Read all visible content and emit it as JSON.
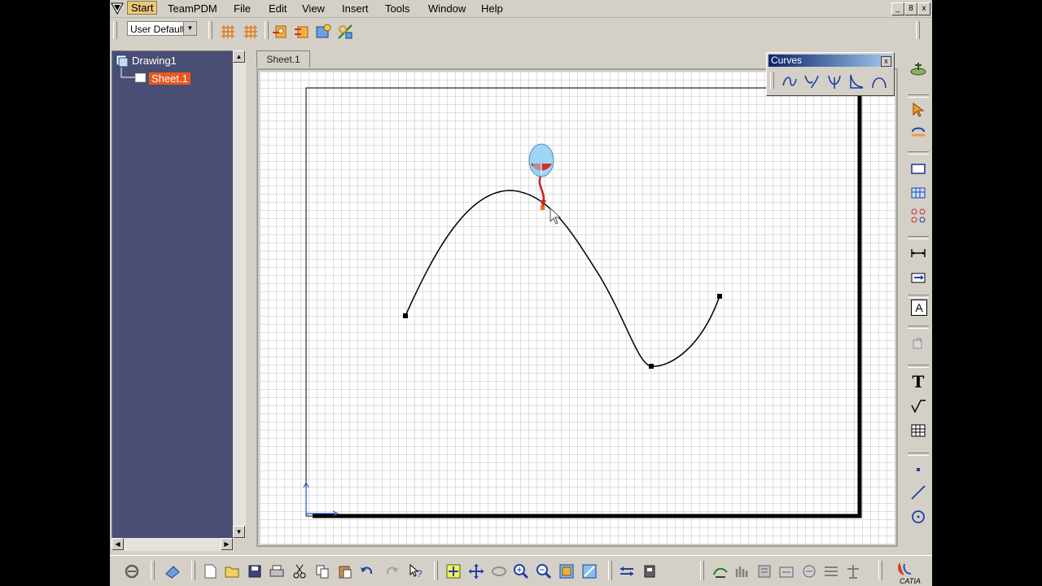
{
  "menu": {
    "items": [
      "Start",
      "TeamPDM",
      "File",
      "Edit",
      "View",
      "Insert",
      "Tools",
      "Window",
      "Help"
    ],
    "window_controls": [
      "_",
      "8",
      "x"
    ]
  },
  "toolbar": {
    "style_select_value": "User Default"
  },
  "tree": {
    "root_label": "Drawing1",
    "child_label": "Sheet.1"
  },
  "sheet_tab": "Sheet.1",
  "curves_toolbar": {
    "title": "Curves",
    "close": "x",
    "tools": [
      "spline-icon",
      "connect-curve-icon",
      "parabola-icon",
      "hyperbola-icon",
      "conic-icon"
    ]
  },
  "right_toolbar": {
    "tools": [
      "select-icon",
      "rotate-view-icon",
      "frame-icon",
      "view-grid-icon",
      "constraint-icon",
      "dimension-icon",
      "dimension-chain-icon",
      "text-box-icon",
      "annotation-icon",
      "text-icon",
      "roughness-icon",
      "table-icon",
      "point-icon",
      "line-icon",
      "circle-icon"
    ],
    "text_tool_glyph": "T",
    "text_box_glyph": "A"
  },
  "bottom_toolbar": {
    "tools": [
      "update-icon",
      "eraser-icon",
      "new-icon",
      "open-icon",
      "save-icon",
      "print-icon",
      "cut-icon",
      "copy-icon",
      "paste-icon",
      "undo-icon",
      "redo-icon",
      "help-icon",
      "fit-all-icon",
      "pan-icon",
      "rotate-icon",
      "zoom-in-icon",
      "zoom-out-icon",
      "normal-view-icon",
      "view-mode-icon",
      "dimension-tool-icon",
      "spec-icon",
      "workbench-icons",
      "catia-logo"
    ],
    "brand_text": "CATIA"
  },
  "colors": {
    "tree_bg": "#4a4e74",
    "selection": "#e8581c",
    "title_bar": "#0a246a"
  }
}
